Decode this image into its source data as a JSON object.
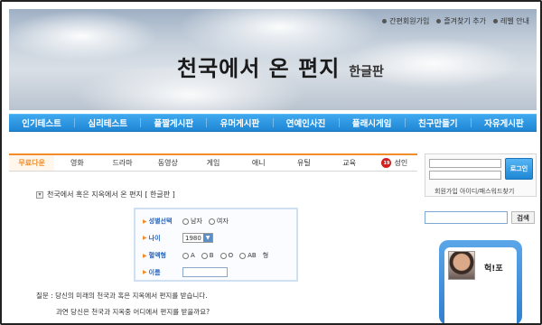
{
  "header": {
    "top_links": [
      "간편회원가입",
      "즐겨찾기 추가",
      "레벨 안내"
    ],
    "title": "천국에서 온 편지",
    "subtitle": "한글판"
  },
  "nav": [
    "인기테스트",
    "심리테스트",
    "플짤게시판",
    "유머게시판",
    "연예인사진",
    "플래시게임",
    "친구만들기",
    "자유게시판"
  ],
  "tabs": [
    "무료다운",
    "영화",
    "드라마",
    "동영상",
    "게임",
    "애니",
    "유틸",
    "교육",
    "성인"
  ],
  "tab_badge": "19",
  "main": {
    "crumb": "천국에서 혹은 지옥에서 온 편지 [ 한글판 ]",
    "form": {
      "gender_label": "성별선택",
      "gender_options": [
        "남자",
        "여자"
      ],
      "age_label": "나이",
      "age_value": "1980",
      "blood_label": "혈액형",
      "blood_options": [
        "A",
        "B",
        "O",
        "AB"
      ],
      "blood_suffix": "형",
      "name_label": "이름"
    },
    "question_line1": "질문 : 당신의 미래의 천국과 혹은 지옥에서 편지를 받습니다.",
    "question_line2": "과연 당신은 천국과 지옥중 어디에서 편지를 받을까요?"
  },
  "sidebar": {
    "login_button": "로그인",
    "login_links": "회원가입 아이디/패스워드찾기",
    "search_button": "검색",
    "profile_name": "헉!포"
  }
}
